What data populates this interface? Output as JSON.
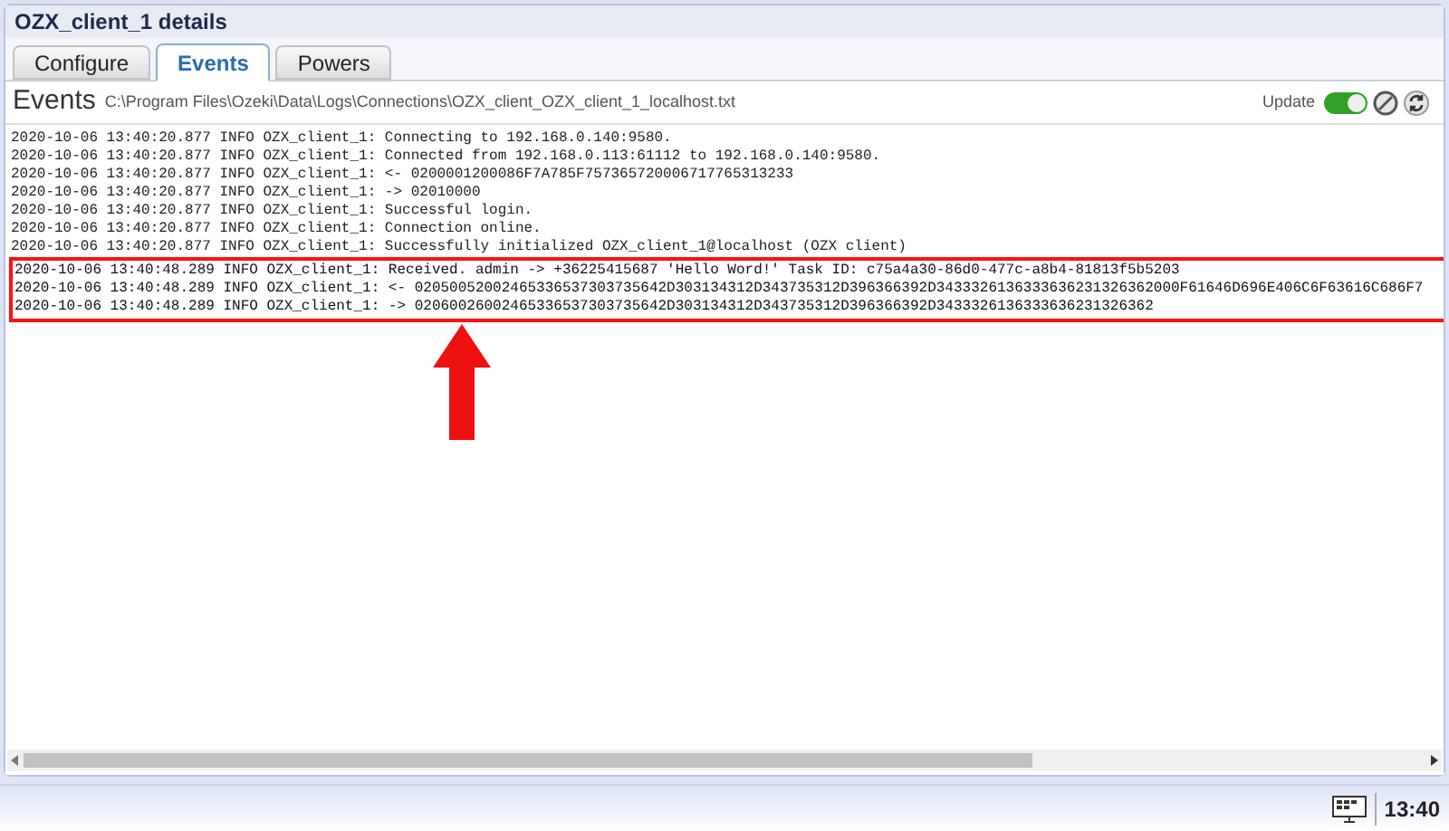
{
  "window": {
    "title": "OZX_client_1 details"
  },
  "tabs": [
    {
      "label": "Configure",
      "selected": false
    },
    {
      "label": "Events",
      "selected": true
    },
    {
      "label": "Powers",
      "selected": false
    }
  ],
  "header": {
    "title": "Events",
    "path": "C:\\Program Files\\Ozeki\\Data\\Logs\\Connections\\OZX_client_OZX_client_1_localhost.txt",
    "update_label": "Update",
    "update_on": true
  },
  "log_lines": [
    {
      "text": "2020-10-06 13:40:20.877 INFO OZX_client_1: Connecting to 192.168.0.140:9580.",
      "highlighted": false
    },
    {
      "text": "2020-10-06 13:40:20.877 INFO OZX_client_1: Connected from 192.168.0.113:61112 to 192.168.0.140:9580.",
      "highlighted": false
    },
    {
      "text": "2020-10-06 13:40:20.877 INFO OZX_client_1: <- 0200001200086F7A785F757365720006717765313233",
      "highlighted": false
    },
    {
      "text": "2020-10-06 13:40:20.877 INFO OZX_client_1: -> 02010000",
      "highlighted": false
    },
    {
      "text": "2020-10-06 13:40:20.877 INFO OZX_client_1: Successful login.",
      "highlighted": false
    },
    {
      "text": "2020-10-06 13:40:20.877 INFO OZX_client_1: Connection online.",
      "highlighted": false
    },
    {
      "text": "2020-10-06 13:40:20.877 INFO OZX_client_1: Successfully initialized OZX_client_1@localhost (OZX client)",
      "highlighted": false
    },
    {
      "text": "2020-10-06 13:40:48.289 INFO OZX_client_1: Received. admin -> +36225415687 'Hello Word!' Task ID: c75a4a30-86d0-477c-a8b4-81813f5b5203",
      "highlighted": true
    },
    {
      "text": "2020-10-06 13:40:48.289 INFO OZX_client_1: <- 02050052002465336537303735642D303134312D343735312D396366392D3433326136333636231326362000F61646D696E406C6F63616C686F7",
      "highlighted": true
    },
    {
      "text": "2020-10-06 13:40:48.289 INFO OZX_client_1: -> 02060026002465336537303735642D303134312D343735312D396366392D3433326136333636231326362",
      "highlighted": true
    }
  ],
  "taskbar": {
    "clock": "13:40"
  }
}
